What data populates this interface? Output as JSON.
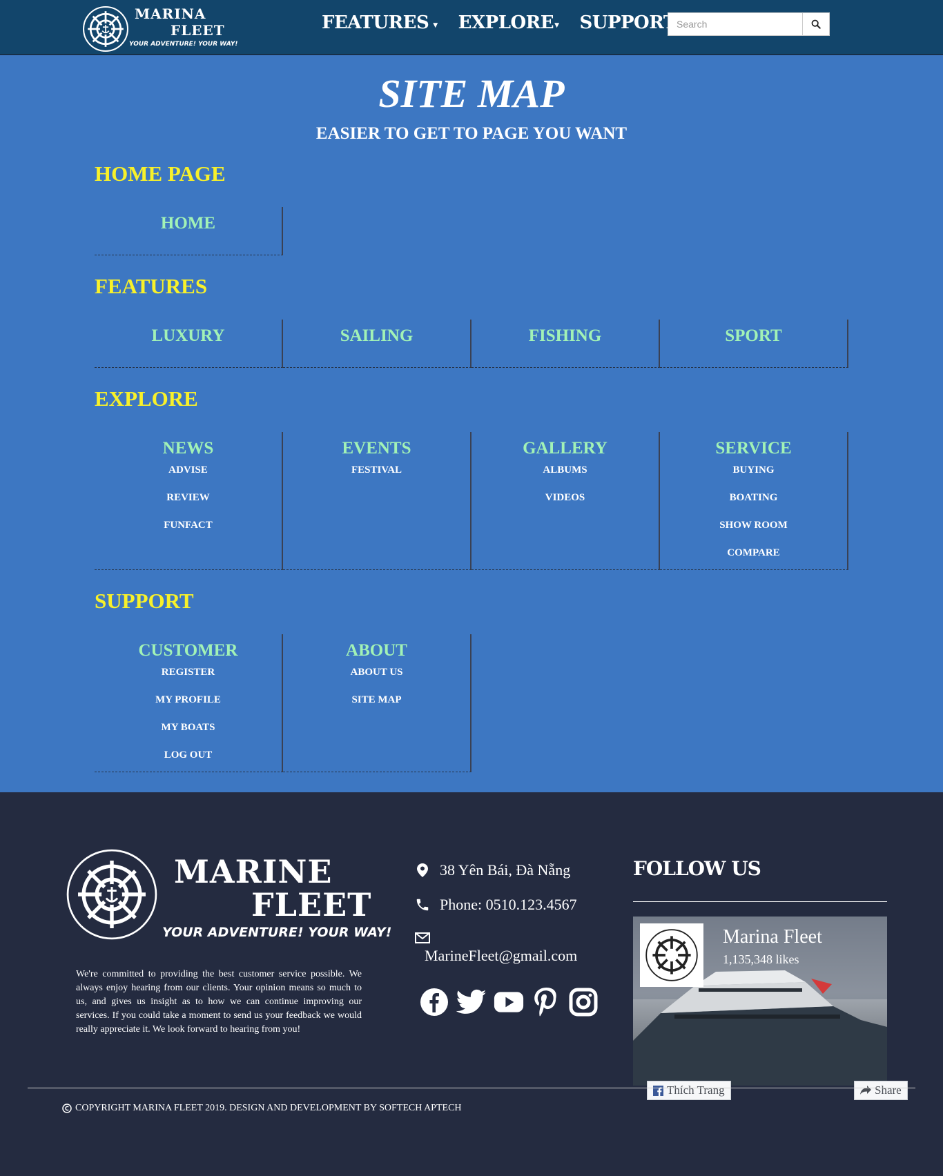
{
  "brand": {
    "line1": "MARINA",
    "line2": "FLEET",
    "tagline": "YOUR ADVENTURE! YOUR WAY!"
  },
  "nav": {
    "items": [
      {
        "label": "FEATURES"
      },
      {
        "label": "EXPLORE"
      },
      {
        "label": "SUPPORT"
      }
    ],
    "search_placeholder": "Search"
  },
  "page": {
    "title": "SITE MAP",
    "subtitle": "EASIER TO GET TO PAGE YOU WANT"
  },
  "sections": {
    "home": {
      "title": "HOME PAGE",
      "columns": [
        {
          "title": "HOME",
          "links": []
        }
      ]
    },
    "features": {
      "title": "FEATURES",
      "columns": [
        {
          "title": "LUXURY",
          "links": []
        },
        {
          "title": "SAILING",
          "links": []
        },
        {
          "title": "FISHING",
          "links": []
        },
        {
          "title": "SPORT",
          "links": []
        }
      ]
    },
    "explore": {
      "title": "EXPLORE",
      "columns": [
        {
          "title": "NEWS",
          "links": [
            "ADVISE",
            "REVIEW",
            "FUNFACT"
          ]
        },
        {
          "title": "EVENTS",
          "links": [
            "FESTIVAL"
          ]
        },
        {
          "title": "GALLERY",
          "links": [
            "ALBUMS",
            "VIDEOS"
          ]
        },
        {
          "title": "SERVICE",
          "links": [
            "BUYING",
            "BOATING",
            "SHOW ROOM",
            "COMPARE"
          ]
        }
      ]
    },
    "support": {
      "title": "SUPPORT",
      "columns": [
        {
          "title": "CUSTOMER",
          "links": [
            "REGISTER",
            "MY PROFILE",
            "MY BOATS",
            "LOG OUT"
          ]
        },
        {
          "title": "ABOUT",
          "links": [
            "ABOUT US",
            "SITE MAP"
          ]
        }
      ]
    }
  },
  "footer": {
    "brand_line1": "MARINE",
    "brand_line2": "FLEET",
    "brand_tagline": "YOUR ADVENTURE! YOUR WAY!",
    "description": "We're committed to providing the best customer service possible. We always enjoy hearing from our clients. Your opinion means so much to us, and gives us insight as to how we can continue improving our services. If you could take a moment to send us your feedback we would really appreciate it. We look forward to hearing from you!",
    "address": "38 Yên Bái, Đà Nẵng",
    "phone": "Phone: 0510.123.4567",
    "email": "MarineFleet@gmail.com",
    "follow_title": "FOLLOW US",
    "fb_page_name": "Marina Fleet",
    "fb_likes": "1,135,348 likes",
    "fb_like_button": "Thích Trang",
    "fb_share_button": "Share",
    "copyright": "COPYRIGHT MARINA FLEET 2019. DESIGN AND DEVELOPMENT BY SOFTECH APTECH"
  },
  "colors": {
    "nav_bg": "#12456b",
    "main_bg": "#3d77c2",
    "footer_bg": "#242b40",
    "section_title": "#f8f12a",
    "column_title": "#a2f2b6"
  },
  "icons": [
    "ship-wheel-icon",
    "search-icon",
    "map-marker-icon",
    "phone-icon",
    "envelope-icon",
    "facebook-icon",
    "twitter-icon",
    "youtube-icon",
    "pinterest-icon",
    "instagram-icon",
    "copyright-icon",
    "share-icon"
  ]
}
